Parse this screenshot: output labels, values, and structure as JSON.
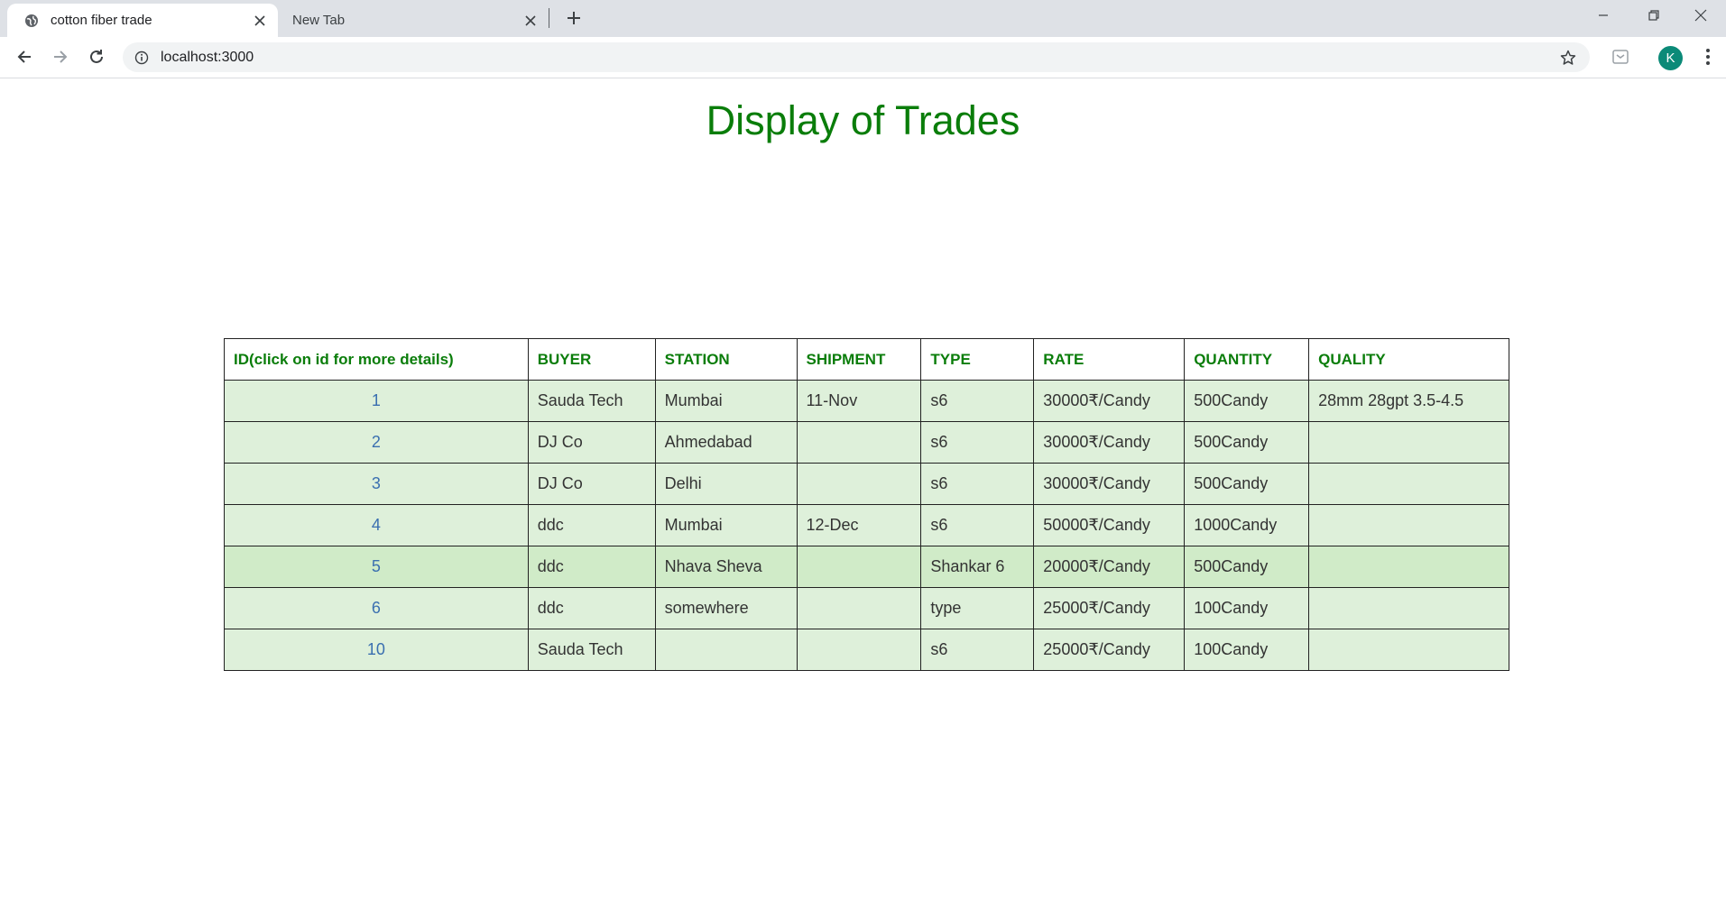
{
  "browser": {
    "tabs": [
      {
        "title": "cotton fiber trade",
        "active": true
      },
      {
        "title": "New Tab",
        "active": false
      }
    ],
    "url": "localhost:3000",
    "profile_initial": "K"
  },
  "page": {
    "title": "Display of Trades",
    "title_color": "#0a7d0a"
  },
  "table": {
    "headers": [
      "ID(click on id for more details)",
      "BUYER",
      "STATION",
      "SHIPMENT",
      "TYPE",
      "RATE",
      "QUANTITY",
      "QUALITY"
    ],
    "rows": [
      {
        "id": "1",
        "buyer": "Sauda Tech",
        "station": "Mumbai",
        "shipment": "11-Nov",
        "type": "s6",
        "rate": "30000₹/Candy",
        "quantity": "500Candy",
        "quality": "28mm 28gpt 3.5-4.5"
      },
      {
        "id": "2",
        "buyer": "DJ Co",
        "station": "Ahmedabad",
        "shipment": "",
        "type": "s6",
        "rate": "30000₹/Candy",
        "quantity": "500Candy",
        "quality": ""
      },
      {
        "id": "3",
        "buyer": "DJ Co",
        "station": "Delhi",
        "shipment": "",
        "type": "s6",
        "rate": "30000₹/Candy",
        "quantity": "500Candy",
        "quality": ""
      },
      {
        "id": "4",
        "buyer": "ddc",
        "station": "Mumbai",
        "shipment": "12-Dec",
        "type": "s6",
        "rate": "50000₹/Candy",
        "quantity": "1000Candy",
        "quality": ""
      },
      {
        "id": "5",
        "buyer": "ddc",
        "station": "Nhava Sheva",
        "shipment": "",
        "type": "Shankar 6",
        "rate": "20000₹/Candy",
        "quantity": "500Candy",
        "quality": ""
      },
      {
        "id": "6",
        "buyer": "ddc",
        "station": "somewhere",
        "shipment": "",
        "type": "type",
        "rate": "25000₹/Candy",
        "quantity": "100Candy",
        "quality": ""
      },
      {
        "id": "10",
        "buyer": "Sauda Tech",
        "station": "",
        "shipment": "",
        "type": "s6",
        "rate": "25000₹/Candy",
        "quantity": "100Candy",
        "quality": ""
      }
    ]
  }
}
